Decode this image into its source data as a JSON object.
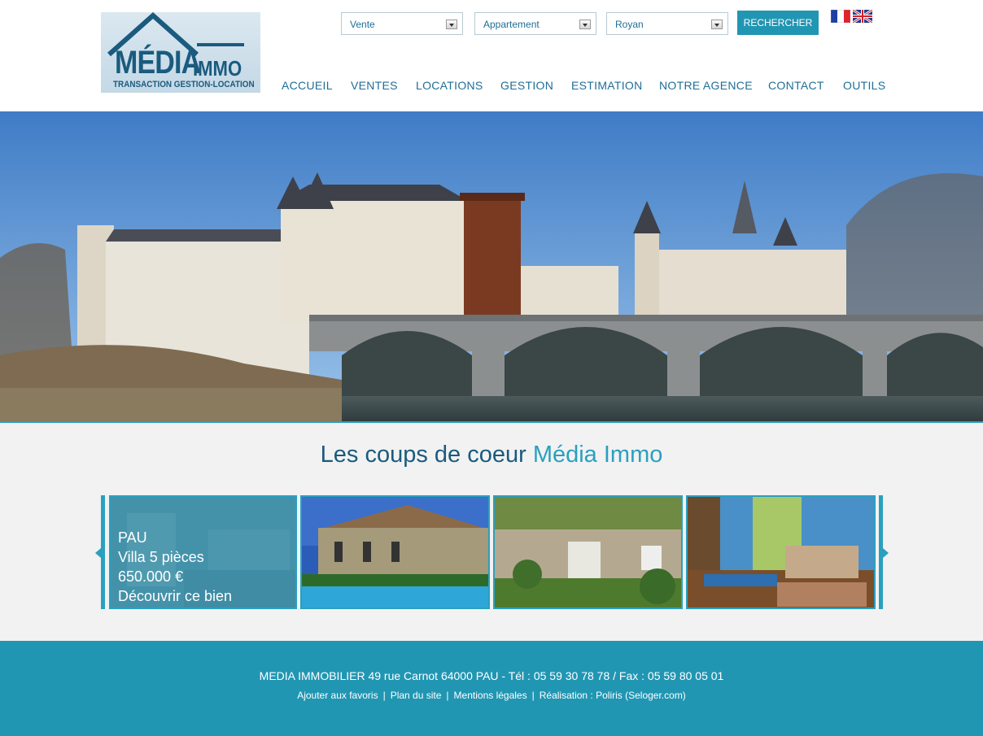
{
  "logo": {
    "brand": "MÉDIA",
    "brand_second": "IMMO",
    "tagline": "TRANSACTION GESTION-LOCATION"
  },
  "search": {
    "transaction_value": "Vente",
    "property_type_value": "Appartement",
    "city_value": "Royan",
    "button_label": "RECHERCHER"
  },
  "languages": [
    {
      "name": "french-flag-icon"
    },
    {
      "name": "uk-flag-icon"
    }
  ],
  "nav": {
    "items": [
      "ACCUEIL",
      "VENTES",
      "LOCATIONS",
      "GESTION",
      "ESTIMATION",
      "NOTRE AGENCE",
      "CONTACT",
      "OUTILS"
    ]
  },
  "featured": {
    "title_prefix": "Les coups de coeur ",
    "title_accent": "Média Immo",
    "cards": [
      {
        "city": "PAU",
        "type": "Villa 5 pièces",
        "price": "650.000 €",
        "cta": "Découvrir ce bien"
      }
    ]
  },
  "footer": {
    "address_line": "MEDIA IMMOBILIER 49 rue Carnot 64000 PAU - Tél : 05 59 30 78 78 / Fax : 05 59 80 05 01",
    "links": [
      "Ajouter aux favoris",
      "Plan du site",
      "Mentions légales",
      "Réalisation : Poliris (Seloger.com)"
    ],
    "separator": "|"
  },
  "colors": {
    "accent": "#2aa0bf",
    "brand": "#1a5b7e",
    "footer_bg": "#2196b3"
  }
}
